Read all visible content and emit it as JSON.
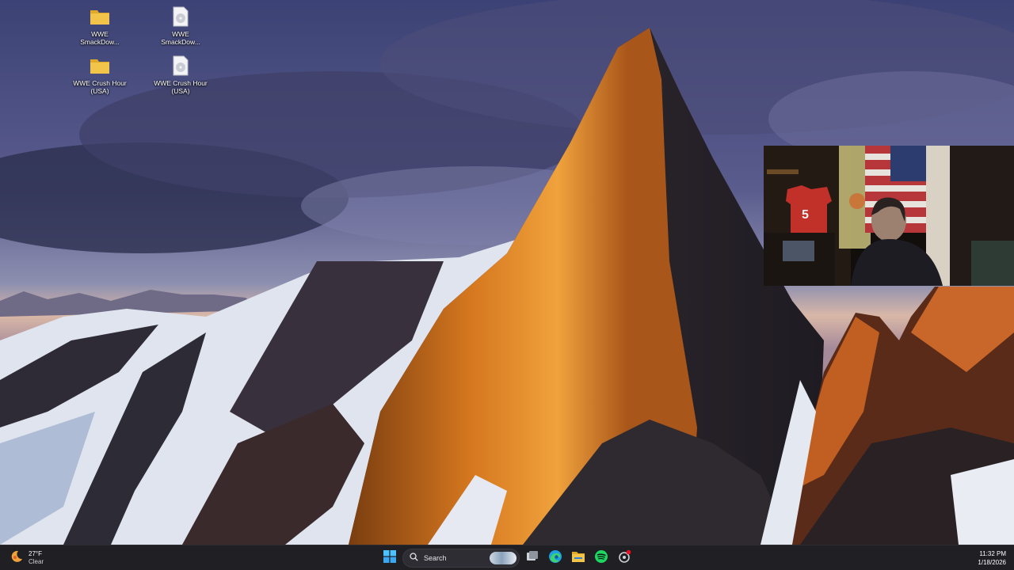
{
  "desktop": {
    "icons": [
      {
        "label": "WWE SmackDow...",
        "type": "folder"
      },
      {
        "label": "WWE SmackDow...",
        "type": "disc-image"
      },
      {
        "label": "WWE Crush Hour (USA)",
        "type": "folder"
      },
      {
        "label": "WWE Crush Hour (USA)",
        "type": "disc-image"
      }
    ]
  },
  "taskbar": {
    "weather": {
      "temp": "27°F",
      "condition": "Clear",
      "icon": "moon-weather-icon"
    },
    "start_icon": "windows-start-icon",
    "search": {
      "label": "Search",
      "icon": "search-icon"
    },
    "pinned": [
      {
        "name": "task-view",
        "icon": "task-view-icon"
      },
      {
        "name": "edge",
        "icon": "edge-browser-icon"
      },
      {
        "name": "file-explorer",
        "icon": "folder-icon"
      },
      {
        "name": "spotify",
        "icon": "spotify-icon"
      },
      {
        "name": "app-with-notification",
        "icon": "gear-notification-icon"
      }
    ],
    "clock": {
      "time": "11:32 PM",
      "date": "1/18/2026"
    }
  },
  "colors": {
    "taskbar_bg": "#1f1f24",
    "folder_yellow": "#f3c44a",
    "spotify_green": "#1ed760",
    "edge_blue": "#1da1e2",
    "notification_red": "#e81123"
  }
}
